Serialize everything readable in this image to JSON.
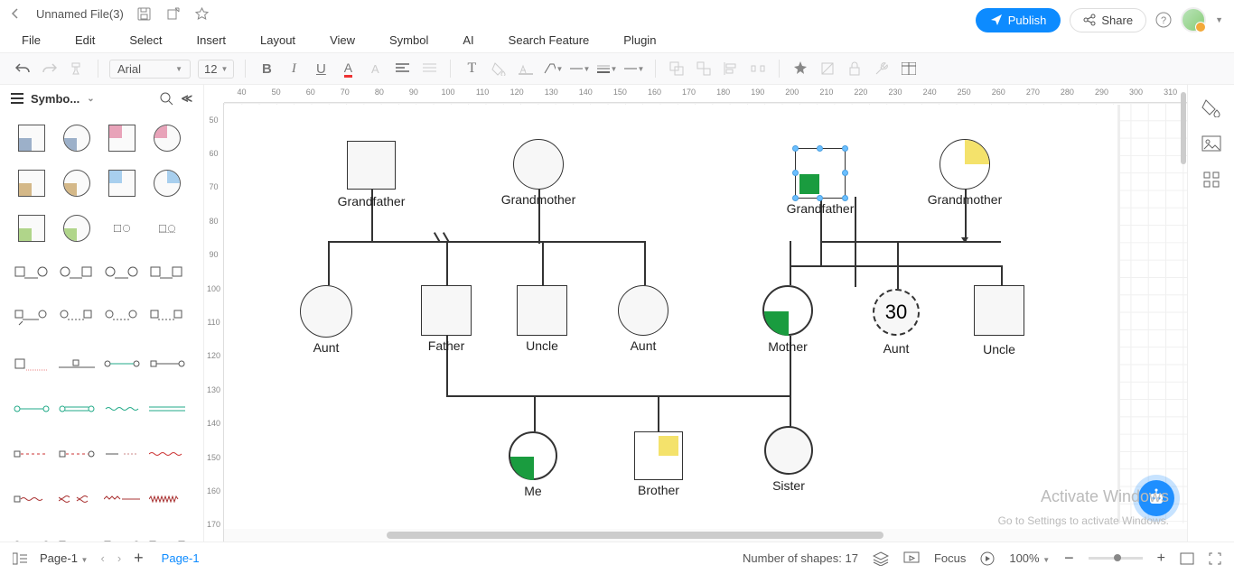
{
  "titlebar": {
    "filename": "Unnamed File(3)"
  },
  "menu": [
    "File",
    "Edit",
    "Select",
    "Insert",
    "Layout",
    "View",
    "Symbol",
    "AI",
    "Search Feature",
    "Plugin"
  ],
  "header_buttons": {
    "publish": "Publish",
    "share": "Share"
  },
  "toolbar": {
    "font": "Arial",
    "size": "12"
  },
  "left_panel": {
    "title": "Symbo..."
  },
  "ruler_h": [
    "40",
    "50",
    "60",
    "70",
    "80",
    "90",
    "100",
    "110",
    "120",
    "130",
    "140",
    "150",
    "160",
    "170",
    "180",
    "190",
    "200",
    "210",
    "220",
    "230",
    "240",
    "250",
    "260",
    "270",
    "280",
    "290",
    "300",
    "310"
  ],
  "ruler_v": [
    "50",
    "60",
    "70",
    "80",
    "90",
    "100",
    "110",
    "120",
    "130",
    "140",
    "150",
    "160",
    "170"
  ],
  "shapes": {
    "gf1": "Grandfather",
    "gm1": "Grandmother",
    "gf2": "Grandfather",
    "gm2": "Grandmother",
    "aunt1": "Aunt",
    "father": "Father",
    "uncle1": "Uncle",
    "aunt2": "Aunt",
    "mother": "Mother",
    "aunt3": "Aunt",
    "aunt3_age": "30",
    "uncle2": "Uncle",
    "me": "Me",
    "brother": "Brother",
    "sister": "Sister"
  },
  "statusbar": {
    "page_sel": "Page-1",
    "page_tab": "Page-1",
    "shape_count": "Number of shapes: 17",
    "focus": "Focus",
    "zoom": "100%"
  },
  "watermark": {
    "l1": "Activate Windows",
    "l2": "Go to Settings to activate Windows."
  }
}
